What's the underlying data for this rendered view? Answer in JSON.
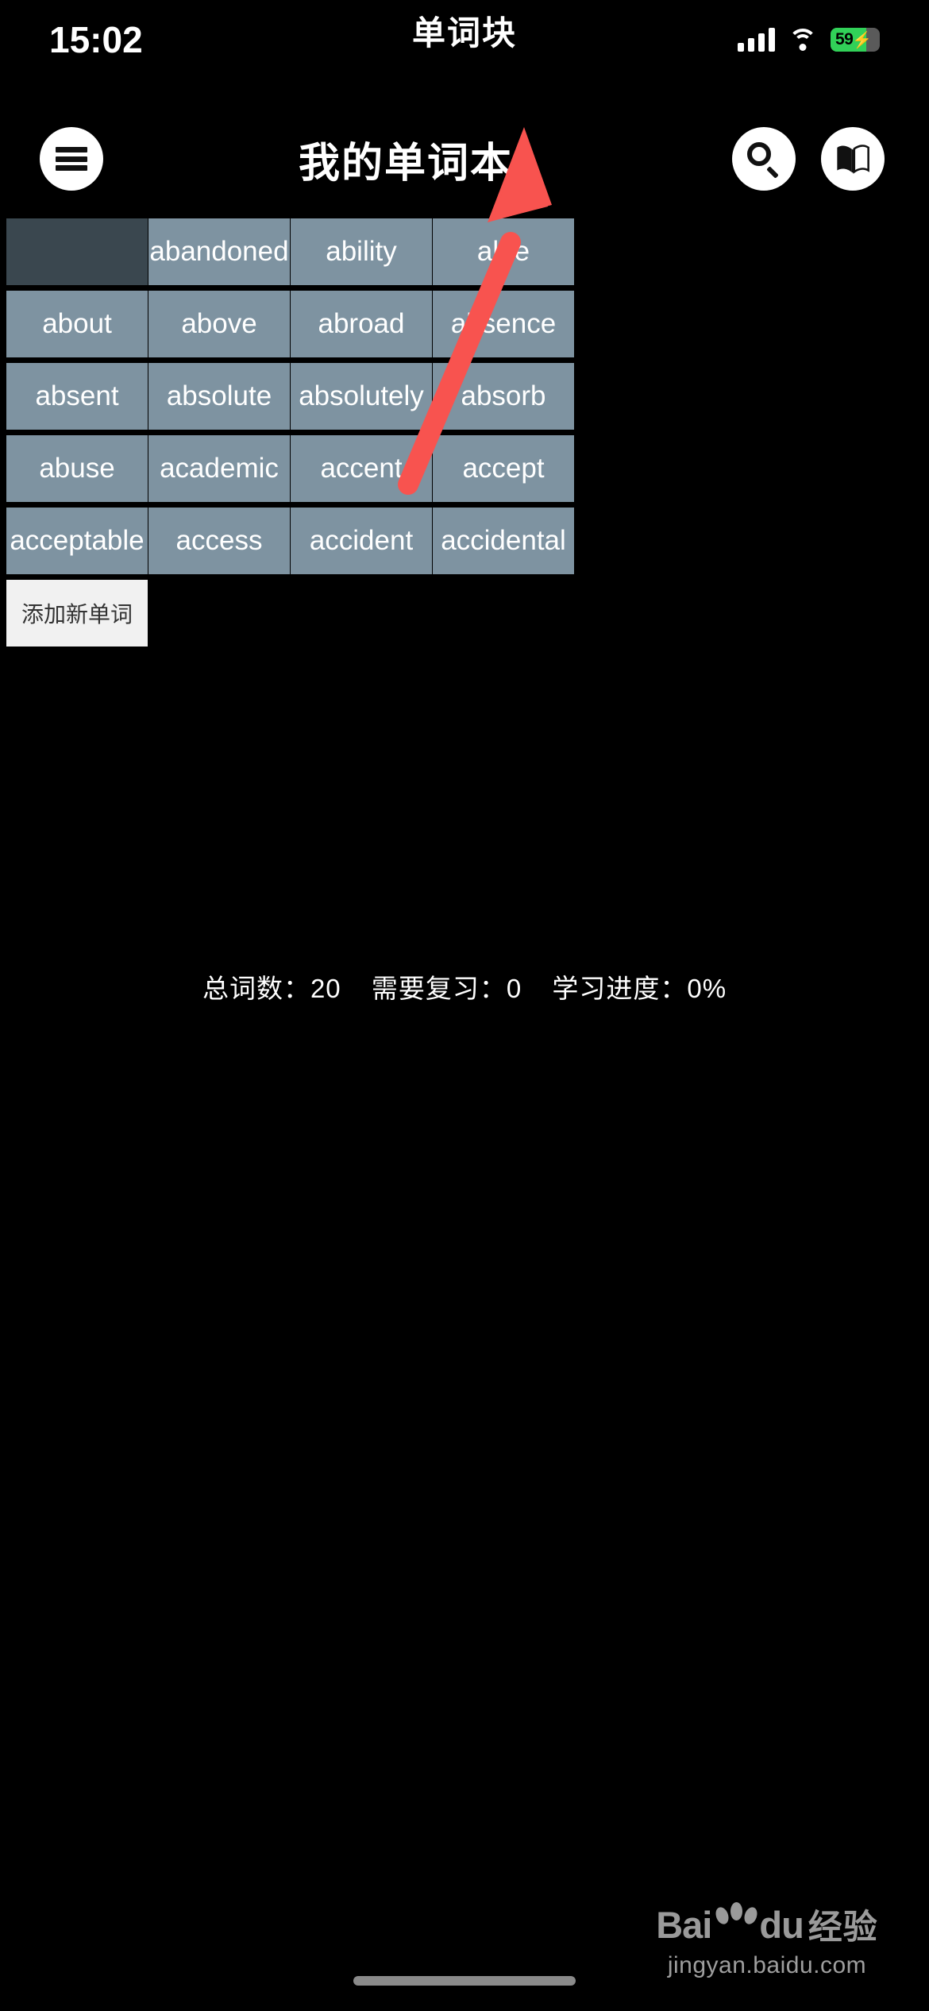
{
  "status_bar": {
    "time": "15:02",
    "app_title": "单词块",
    "battery_percent": "59",
    "battery_charging_glyph": "⚡",
    "battery_color": "#31d158",
    "signal_icon": "cellular-signal-icon",
    "wifi_icon": "wifi-icon"
  },
  "nav": {
    "menu_icon": "hamburger-menu-icon",
    "title": "我的单词本",
    "search_icon": "search-icon",
    "book_icon": "open-book-icon"
  },
  "grid": {
    "empty_tile_color": "#3a474f",
    "tile_color": "#7e93a1",
    "add_tile_color": "#f1f1f1",
    "tiles": [
      {
        "label": "",
        "type": "empty"
      },
      {
        "label": "abandoned",
        "type": "word"
      },
      {
        "label": "ability",
        "type": "word"
      },
      {
        "label": "able",
        "type": "word"
      },
      {
        "label": "about",
        "type": "word"
      },
      {
        "label": "above",
        "type": "word"
      },
      {
        "label": "abroad",
        "type": "word"
      },
      {
        "label": "absence",
        "type": "word"
      },
      {
        "label": "absent",
        "type": "word"
      },
      {
        "label": "absolute",
        "type": "word"
      },
      {
        "label": "absolutely",
        "type": "word"
      },
      {
        "label": "absorb",
        "type": "word"
      },
      {
        "label": "abuse",
        "type": "word"
      },
      {
        "label": "academic",
        "type": "word"
      },
      {
        "label": "accent",
        "type": "word"
      },
      {
        "label": "accept",
        "type": "word"
      },
      {
        "label": "acceptable",
        "type": "word"
      },
      {
        "label": "access",
        "type": "word"
      },
      {
        "label": "accident",
        "type": "word"
      },
      {
        "label": "accidental",
        "type": "word"
      },
      {
        "label": "添加新单词",
        "type": "add"
      }
    ]
  },
  "stats": {
    "total_label": "总词数：20",
    "review_label": "需要复习：0",
    "progress_label": "学习进度：0%"
  },
  "annotation": {
    "arrow_color": "#f8534f",
    "arrow_icon": "red-arrow-annotation"
  },
  "watermark": {
    "brand": "Bai",
    "brand_tail": "du",
    "brand_cn": "经验",
    "url": "jingyan.baidu.com"
  },
  "home_indicator": "home-indicator"
}
